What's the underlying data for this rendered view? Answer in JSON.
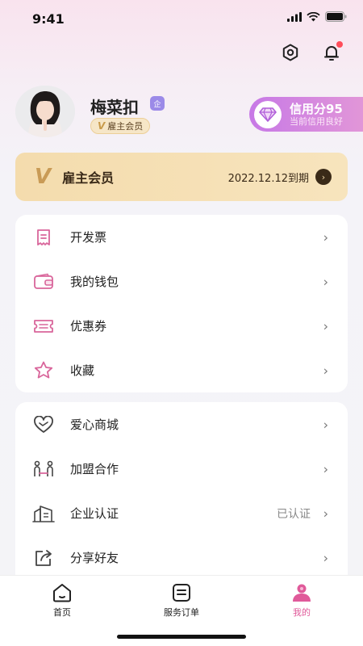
{
  "status_bar": {
    "time": "9:41"
  },
  "profile": {
    "name": "梅菜扣",
    "verified_badge": "企",
    "member_tag_v": "V",
    "member_tag": "雇主会员"
  },
  "credit": {
    "score_label": "信用分95",
    "sub_label": "当前信用良好"
  },
  "membership": {
    "logo": "V",
    "title": "雇主会员",
    "expiry": "2022.12.12到期",
    "arrow": "›"
  },
  "menu_group_1": [
    {
      "label": "开发票",
      "icon": "invoice-icon"
    },
    {
      "label": "我的钱包",
      "icon": "wallet-icon"
    },
    {
      "label": "优惠券",
      "icon": "coupon-icon"
    },
    {
      "label": "收藏",
      "icon": "star-icon"
    }
  ],
  "menu_group_2": [
    {
      "label": "爱心商城",
      "icon": "heart-icon"
    },
    {
      "label": "加盟合作",
      "icon": "partnership-icon"
    },
    {
      "label": "企业认证",
      "icon": "building-icon",
      "value": "已认证"
    },
    {
      "label": "分享好友",
      "icon": "share-icon"
    }
  ],
  "chevron": "›",
  "tabbar": {
    "home": "首页",
    "orders": "服务订单",
    "mine": "我的"
  },
  "colors": {
    "accent": "#e05a9a",
    "icon_pink": "#d9669b",
    "gold": "#f4dcad",
    "credit_start": "#c779e6",
    "credit_end": "#e59ad6"
  }
}
